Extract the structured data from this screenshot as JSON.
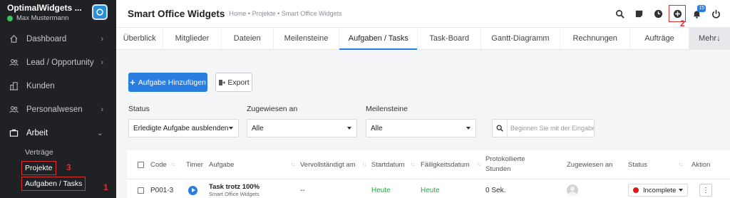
{
  "sidebar": {
    "brand_title": "OptimalWidgets ...",
    "user_name": "Max Mustermann",
    "items": [
      {
        "label": "Dashboard",
        "chevron": "›"
      },
      {
        "label": "Lead / Opportunity",
        "chevron": "›"
      },
      {
        "label": "Kunden",
        "chevron": ""
      },
      {
        "label": "Personalwesen",
        "chevron": "›"
      },
      {
        "label": "Arbeit",
        "chevron": "⌄"
      }
    ],
    "sub_items": [
      "Verträge",
      "Projekte",
      "Aufgaben / Tasks"
    ]
  },
  "annotations": {
    "one": "1",
    "two": "2",
    "three": "3"
  },
  "header": {
    "title": "Smart Office Widgets",
    "breadcrumb": "Home • Projekte • Smart Office Widgets",
    "notification_count": "15"
  },
  "tabs": [
    "Überblick",
    "Mitglieder",
    "Dateien",
    "Meilensteine",
    "Aufgaben / Tasks",
    "Task-Board",
    "Gantt-Diagramm",
    "Rechnungen",
    "Aufträge",
    "Mehr↓"
  ],
  "toolbar": {
    "add_label": "Aufgabe Hinzufügen",
    "export_label": "Export"
  },
  "filters": {
    "status_label": "Status",
    "status_value": "Erledigte Aufgabe ausblenden",
    "assigned_label": "Zugewiesen an",
    "assigned_value": "Alle",
    "milestone_label": "Meilensteine",
    "milestone_value": "Alle",
    "search_placeholder": "Beginnen Sie mit der Eingabe"
  },
  "table": {
    "headers": {
      "code": "Code",
      "timer": "Timer",
      "task": "Aufgabe",
      "completed": "Vervollständigt am",
      "start": "Startdatum",
      "due": "Fälligkeitsdatum",
      "hours_line1": "Protokollierte",
      "hours_line2": "Stunden",
      "assigned": "Zugewiesen an",
      "status": "Status",
      "action": "Aktion"
    },
    "rows": [
      {
        "code": "P001-3",
        "task_title": "Task trotz 100%",
        "task_project": "Smart Office Widgets",
        "completed": "--",
        "start": "Heute",
        "due": "Heute",
        "hours": "0 Sek.",
        "status": "Incomplete"
      }
    ]
  },
  "colors": {
    "accent": "#2a7de1",
    "sidebar_bg": "#1f2125",
    "annotation": "#e02f2f",
    "status_incomplete": "#d9191c",
    "date_green": "#2aa84a"
  }
}
